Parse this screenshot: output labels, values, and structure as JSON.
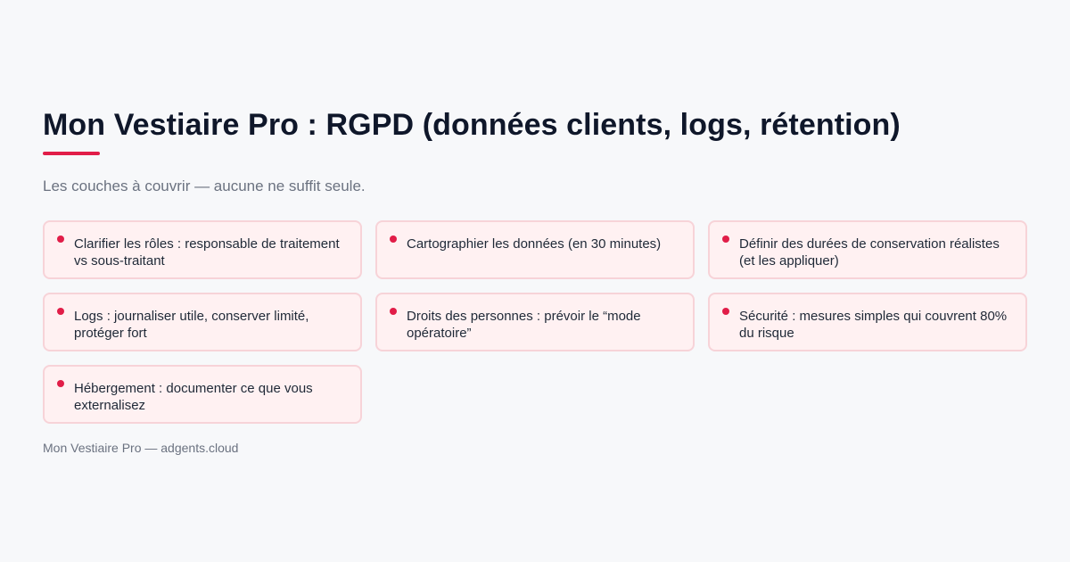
{
  "header": {
    "title": "Mon Vestiaire Pro : RGPD (données clients, logs, rétention)",
    "subtitle": "Les couches à couvrir — aucune ne suffit seule."
  },
  "cards": [
    {
      "text": "Clarifier les rôles : responsable de traitement vs sous-traitant"
    },
    {
      "text": "Cartographier les données (en 30 minutes)"
    },
    {
      "text": "Définir des durées de conservation réalistes (et les appliquer)"
    },
    {
      "text": "Logs : journaliser utile, conserver limité, protéger fort"
    },
    {
      "text": "Droits des personnes : prévoir le “mode opératoire”"
    },
    {
      "text": "Sécurité : mesures simples qui couvrent 80% du risque"
    },
    {
      "text": "Hébergement : documenter ce que vous externalisez"
    }
  ],
  "footer": {
    "text": "Mon Vestiaire Pro — adgents.cloud"
  },
  "colors": {
    "accent": "#e11d48",
    "card_background": "#fff1f2",
    "card_border": "#f7d3d8",
    "page_background": "#f7f8fa"
  }
}
